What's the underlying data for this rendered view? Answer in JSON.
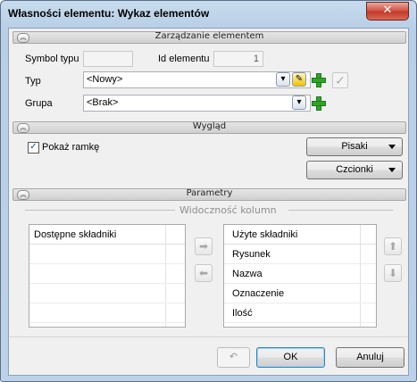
{
  "window": {
    "title": "Własności elementu: Wykaz elementów",
    "close_label": "✕"
  },
  "sections": {
    "manage": "Zarządzanie elementem",
    "look": "Wygląd",
    "params": "Parametry"
  },
  "manage": {
    "symbol_label": "Symbol typu",
    "symbol_value": "",
    "id_label": "Id elementu",
    "id_value": "1",
    "type_label": "Typ",
    "type_value": "<Nowy>",
    "group_label": "Grupa",
    "group_value": "<Brak>"
  },
  "look": {
    "frame_checkbox_label": "Pokaż ramkę",
    "frame_checked": true,
    "pens_button": "Pisaki",
    "fonts_button": "Czcionki"
  },
  "params": {
    "group_title": "Widoczność kolumn",
    "available_header": "Dostępne składniki",
    "available_items": [],
    "used_header": "Użyte składniki",
    "used_items": [
      "Rysunek",
      "Nazwa",
      "Oznaczenie",
      "Ilość"
    ]
  },
  "footer": {
    "ok": "OK",
    "cancel": "Anuluj"
  },
  "icons": {
    "chevron": "chevron-up-icon",
    "arrow_right": "arrow-right-icon",
    "arrow_left": "arrow-left-icon",
    "arrow_up": "arrow-up-icon",
    "arrow_down": "arrow-down-icon",
    "undo": "undo-icon",
    "add": "plus-icon",
    "check": "checkmark-icon"
  }
}
